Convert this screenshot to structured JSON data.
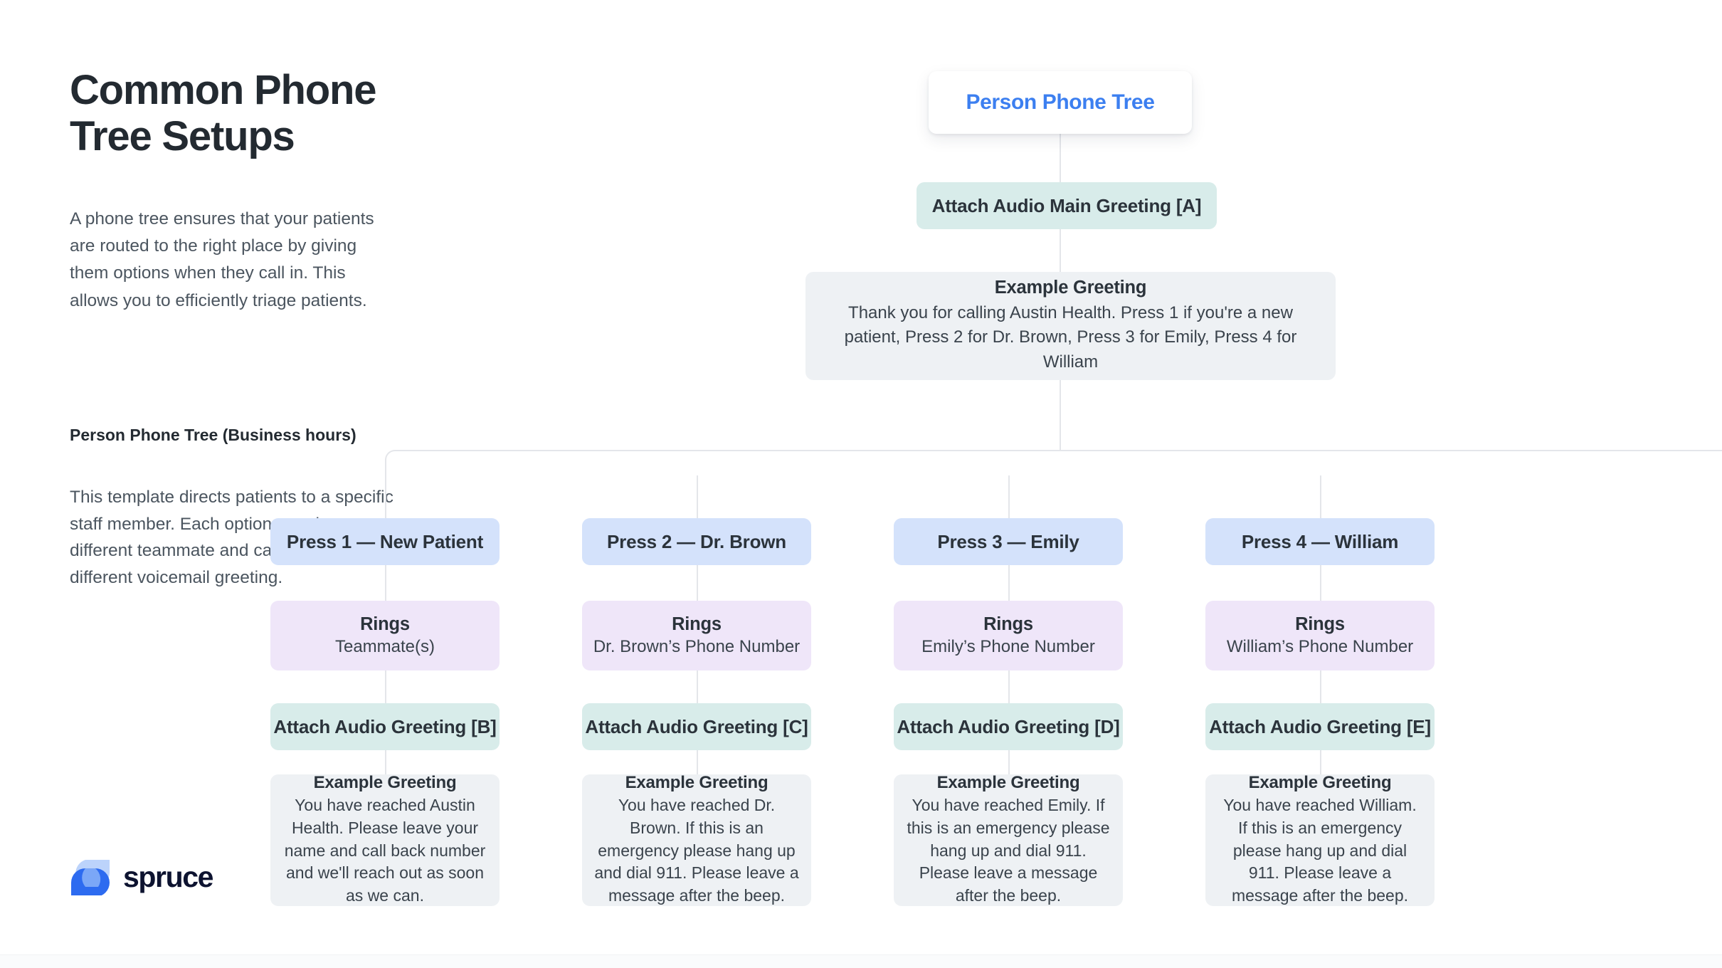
{
  "left": {
    "title": "Common Phone Tree Setups",
    "intro": "A phone tree ensures that your patients are routed to the right place by giving them options when they call in. This allows you to efficiently triage patients.",
    "section_heading": "Person Phone Tree (Business hours)",
    "section_body": "This template directs patients to a specific staff member. Each option can ring a different teammate and can have a different voicemail greeting."
  },
  "brand": {
    "name": "spruce",
    "logo_icon": "spruce-leaf-logo",
    "logo_color_dark": "#2d6bf0",
    "logo_color_light": "#bcd3fb",
    "wordmark_color": "#0d1330"
  },
  "colors": {
    "root_text": "#3c7ff0",
    "audio_bg": "#d8ecea",
    "option_bg": "#d4e2fb",
    "rings_bg": "#efe6f9",
    "greeting_bg": "#eef1f4",
    "connector": "#e4e6ea"
  },
  "tree": {
    "root": "Person Phone Tree",
    "main_audio": "Attach Audio Main Greeting [A]",
    "main_greeting": {
      "label": "Example Greeting",
      "body": "Thank you for calling Austin Health. Press 1 if you're a new patient, Press 2 for Dr. Brown, Press 3 for Emily, Press 4 for William"
    },
    "branches": [
      {
        "option": "Press 1 — New Patient",
        "rings_label": "Rings",
        "rings_value": "Teammate(s)",
        "audio": "Attach Audio Greeting [B]",
        "greeting_label": "Example Greeting",
        "greeting_body": "You have reached Austin Health. Please leave your name and call back number and we'll reach out as soon as we can."
      },
      {
        "option": "Press 2 — Dr. Brown",
        "rings_label": "Rings",
        "rings_value": "Dr. Brown’s Phone Number",
        "audio": "Attach Audio Greeting [C]",
        "greeting_label": "Example Greeting",
        "greeting_body": "You have reached Dr. Brown. If this is an emergency please hang up and dial 911. Please leave a message after the beep."
      },
      {
        "option": "Press 3 — Emily",
        "rings_label": "Rings",
        "rings_value": "Emily’s Phone Number",
        "audio": "Attach Audio Greeting [D]",
        "greeting_label": "Example Greeting",
        "greeting_body": "You have reached Emily. If this is an emergency please hang up and dial 911. Please leave a message after the beep."
      },
      {
        "option": "Press 4 — William",
        "rings_label": "Rings",
        "rings_value": "William’s Phone Number",
        "audio": "Attach Audio Greeting [E]",
        "greeting_label": "Example Greeting",
        "greeting_body": "You have reached William. If this is an emergency please hang up and dial 911. Please leave a message after the beep."
      }
    ]
  }
}
